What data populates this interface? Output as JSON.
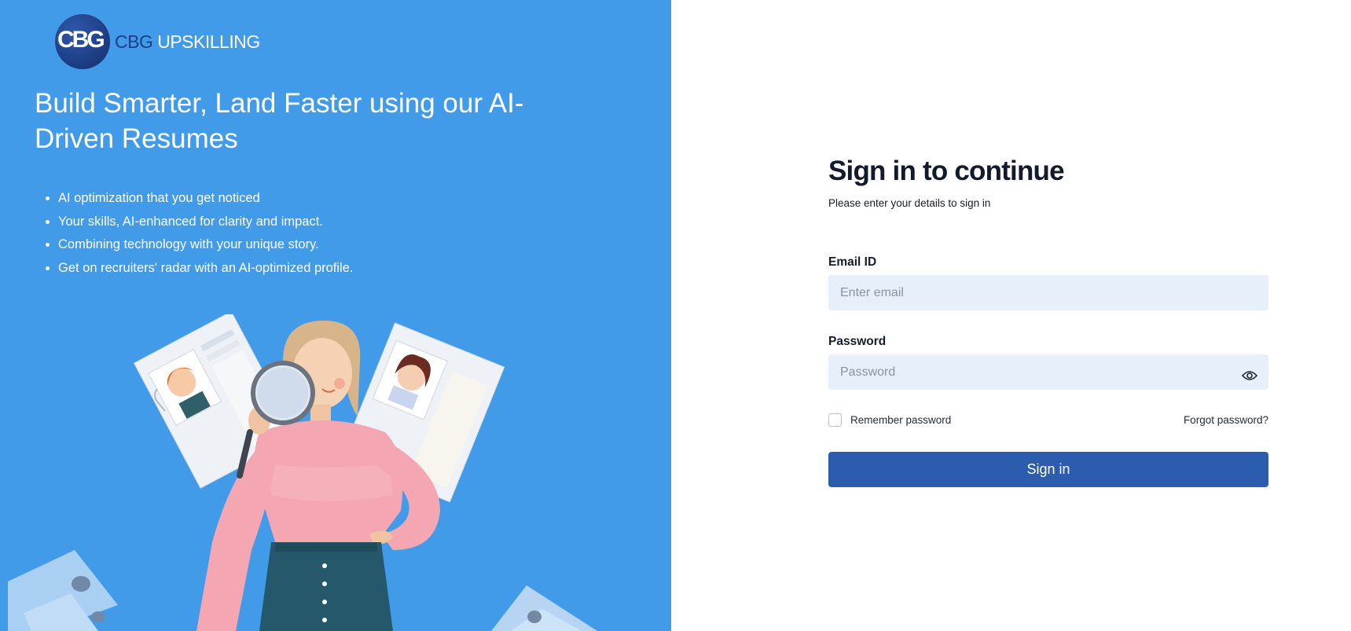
{
  "brand": {
    "badge_text": "CBG",
    "name_prefix": "CBG",
    "name_suffix": " UPSKILLING"
  },
  "hero": {
    "headline": "Build Smarter, Land Faster using our AI-Driven Resumes",
    "features": [
      "AI optimization that you get noticed",
      "Your skills, AI-enhanced for clarity and impact.",
      "Combining technology with your unique story.",
      "Get on recruiters' radar with an AI-optimized profile."
    ]
  },
  "form": {
    "title": "Sign in to continue",
    "subtitle": "Please enter your details to sign in",
    "email_label": "Email ID",
    "email_placeholder": "Enter email",
    "email_value": "",
    "password_label": "Password",
    "password_placeholder": "Password",
    "password_value": "",
    "remember_label": "Remember password",
    "remember_checked": false,
    "forgot_label": "Forgot password?",
    "signin_label": "Sign in"
  },
  "colors": {
    "left_panel_bg": "#429be8",
    "brand_navy": "#1d3f86",
    "primary_button": "#2c5cad",
    "input_bg": "#e7effa"
  },
  "icons": {
    "password_toggle": "eye-icon"
  }
}
